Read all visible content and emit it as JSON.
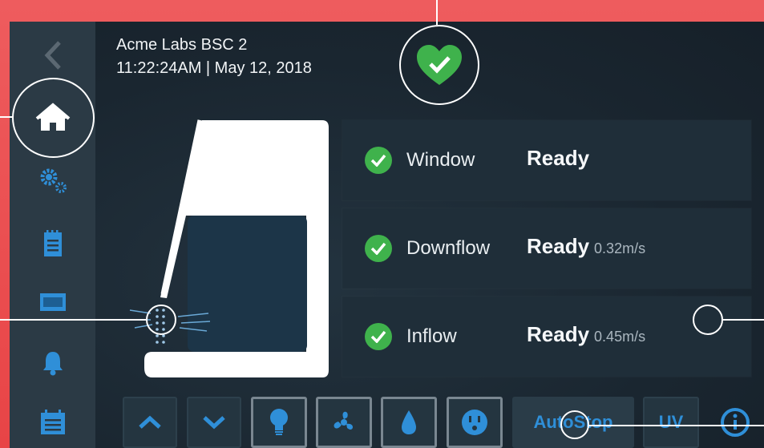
{
  "header": {
    "device_name": "Acme Labs BSC 2",
    "datetime": "11:22:24AM | May 12, 2018"
  },
  "status_icon": "heart-check-icon",
  "rows": [
    {
      "label": "Window",
      "status": "Ready",
      "value": ""
    },
    {
      "label": "Downflow",
      "status": "Ready",
      "value": "0.32m/s"
    },
    {
      "label": "Inflow",
      "status": "Ready",
      "value": "0.45m/s"
    }
  ],
  "sidebar": {
    "items": [
      "back-chevron-icon",
      "home-icon",
      "settings-gears-icon",
      "log-notepad-icon",
      "display-screen-icon",
      "alarm-bell-icon",
      "calendar-icon"
    ]
  },
  "controls": {
    "autostop_label": "AutoStop",
    "uv_label": "UV",
    "buttons": [
      "sash-up-icon",
      "sash-down-icon",
      "light-bulb-icon",
      "fan-icon",
      "gas-drop-icon",
      "outlet-icon",
      "info-icon"
    ]
  },
  "colors": {
    "accent_blue": "#2f8fd8",
    "ok_green": "#3fb24c",
    "frame_red": "#e84446",
    "sidebar": "#2b3a45"
  }
}
